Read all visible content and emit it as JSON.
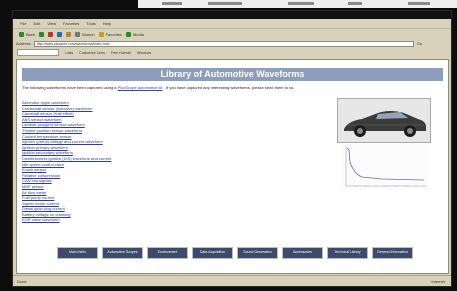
{
  "window": {
    "title": ""
  },
  "menu": [
    "File",
    "Edit",
    "View",
    "Favorites",
    "Tools",
    "Help"
  ],
  "toolbar": {
    "buttons": [
      {
        "label": "Back",
        "icon": "back-arrow-icon",
        "color": "#2b8a2b"
      },
      {
        "label": "",
        "icon": "forward-arrow-icon",
        "color": "#2b8a2b"
      },
      {
        "label": "",
        "icon": "stop-icon",
        "color": "#c03030"
      },
      {
        "label": "",
        "icon": "refresh-icon",
        "color": "#2b6ab0"
      },
      {
        "label": "",
        "icon": "home-icon",
        "color": "#b08a2b"
      },
      {
        "label": "Search",
        "icon": "search-icon",
        "color": "#777"
      },
      {
        "label": "Favorites",
        "icon": "star-icon",
        "color": "#c0a020"
      },
      {
        "label": "Media",
        "icon": "media-icon",
        "color": "#2b8a2b"
      }
    ]
  },
  "address": {
    "label": "Address",
    "value": "http://www.picoauto.com/waveforms/index.html",
    "go": "Go"
  },
  "links_bar": {
    "label": "Links",
    "items": [
      "Customize Links",
      "Free Hotmail",
      "Windows"
    ]
  },
  "page": {
    "banner": "Library of Automotive Waveforms",
    "intro": "The following waveforms have been captured using a",
    "intro_link": "PicoScope automotive kit",
    "intro_rest": ". If you have captured any interesting waveforms, please send them to us.",
    "links": [
      "Alternator ripple waveform",
      "Crankshaft sensor (inductive) waveform",
      "Camshaft sensor (Hall effect)",
      "ABS sensor waveform",
      "Lambda (oxygen) sensor waveform",
      "Throttle position sensor waveform",
      "Coolant temperature sensor",
      "Injector (petrol) voltage and current waveform",
      "Ignition primary waveform",
      "Ignition secondary waveform",
      "Distributorless ignition (DIS) waveform and current",
      "Idle speed control valve",
      "Knock sensor",
      "Relative compression",
      "CAN bus signals",
      "MAP sensor",
      "Air flow meter",
      "Fuel pump current",
      "Starter motor current",
      "Diesel glow plug current",
      "Battery voltage on cranking",
      "EGR valve waveform"
    ]
  },
  "navigation": [
    "Main Index",
    "Automotive Scopes",
    "Environment",
    "Data Acquisition",
    "Sound Generation",
    "Accessories",
    "Technical Library",
    "General Information"
  ],
  "status": {
    "left": "Done",
    "right": "Internet"
  },
  "colors": {
    "banner": "#8f9dbd",
    "nav": "#3e4a6b",
    "link": "#2a3ba8",
    "chrome": "#d8d2bb"
  }
}
